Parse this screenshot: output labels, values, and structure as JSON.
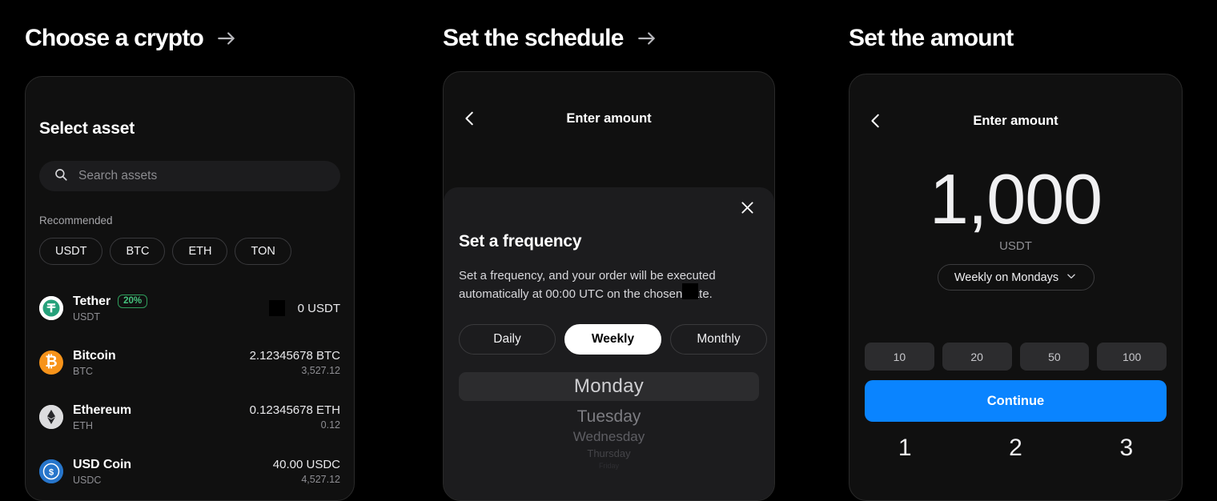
{
  "panels": [
    {
      "heading": "Choose a crypto",
      "has_arrow": true
    },
    {
      "heading": "Set the schedule",
      "has_arrow": true
    },
    {
      "heading": "Set the amount",
      "has_arrow": false
    }
  ],
  "select_asset": {
    "title": "Select asset",
    "search": {
      "placeholder": "Search assets",
      "value": "",
      "icon": "search-icon"
    },
    "recommended_label": "Recommended",
    "chips": [
      "USDT",
      "BTC",
      "ETH",
      "TON"
    ],
    "assets": [
      {
        "name": "Tether",
        "symbol": "USDT",
        "badge": "20%",
        "amount": "0 USDT",
        "fiat": "",
        "icon": "tether-icon"
      },
      {
        "name": "Bitcoin",
        "symbol": "BTC",
        "badge": "",
        "amount": "2.12345678 BTC",
        "fiat": "3,527.12",
        "icon": "bitcoin-icon"
      },
      {
        "name": "Ethereum",
        "symbol": "ETH",
        "badge": "",
        "amount": "0.12345678 ETH",
        "fiat": "0.12",
        "icon": "ethereum-icon"
      },
      {
        "name": "USD Coin",
        "symbol": "USDC",
        "badge": "",
        "amount": "40.00 USDC",
        "fiat": "4,527.12",
        "icon": "usdc-icon"
      }
    ]
  },
  "schedule": {
    "nav_title": "Enter amount",
    "back_icon": "chevron-left-icon",
    "close_icon": "close-icon",
    "sheet_title": "Set a frequency",
    "sheet_desc": "Set a frequency, and your order will be executed automatically at 00:00 UTC on the chosen date.",
    "frequencies": [
      {
        "label": "Daily",
        "selected": false
      },
      {
        "label": "Weekly",
        "selected": true
      },
      {
        "label": "Monthly",
        "selected": false
      }
    ],
    "day_wheel": {
      "selected": "Monday",
      "below": [
        "Tuesday",
        "Wednesday",
        "Thursday",
        "Friday"
      ]
    }
  },
  "amount": {
    "nav_title": "Enter amount",
    "back_icon": "chevron-left-icon",
    "value": "1,000",
    "currency": "USDT",
    "frequency_label": "Weekly on Mondays",
    "frequency_icon": "chevron-down-icon",
    "quick_amounts": [
      "10",
      "20",
      "50",
      "100"
    ],
    "continue_label": "Continue",
    "keypad_row": [
      "1",
      "2",
      "3"
    ]
  },
  "colors": {
    "page_bg": "#000000",
    "card_bg": "#101010",
    "sheet_bg": "#1c1c1e",
    "accent_blue": "#0a84ff",
    "badge_green": "#45c47e",
    "bitcoin_orange": "#f7931a",
    "usdc_blue": "#2775ca",
    "tether_teal": "#26a17b"
  }
}
